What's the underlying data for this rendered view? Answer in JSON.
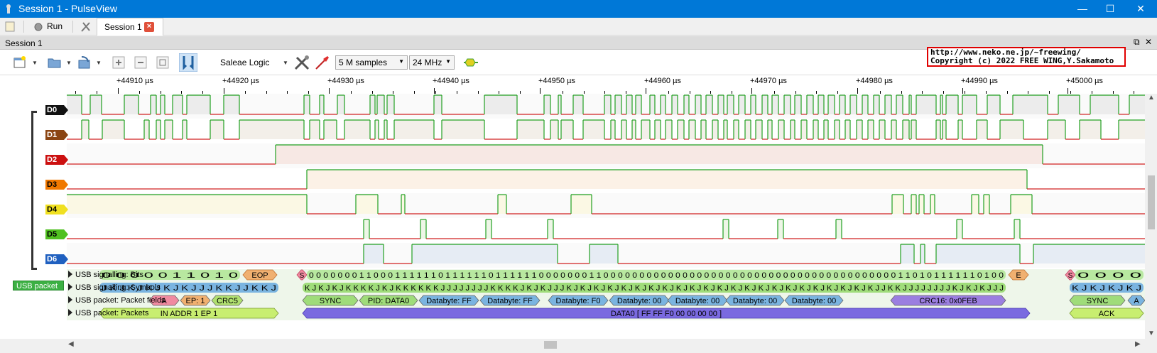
{
  "window": {
    "title": "Session 1 - PulseView",
    "minimize": "—",
    "maximize": "☐",
    "close": "✕"
  },
  "main_toolbar": {
    "run_label": "Run",
    "session_tab_label": "Session 1"
  },
  "session": {
    "header_label": "Session 1",
    "device": "Saleae Logic",
    "samples": "5 M samples",
    "rate": "24 MHz"
  },
  "copyright": {
    "line1": "http://www.neko.ne.jp/~freewing/",
    "line2": "Copyright (c) 2022 FREE WING,Y.Sakamoto"
  },
  "ruler": {
    "labels": [
      "+44910 µs",
      "+44920 µs",
      "+44930 µs",
      "+44940 µs",
      "+44950 µs",
      "+44960 µs",
      "+44970 µs",
      "+44980 µs",
      "+44990 µs",
      "+45000 µs"
    ]
  },
  "channels": [
    {
      "name": "D0",
      "color": "#111111",
      "text": "#ffffff",
      "bg": "#ececec"
    },
    {
      "name": "D1",
      "color": "#8b4513",
      "text": "#ffffff",
      "bg": "#f3efe9"
    },
    {
      "name": "D2",
      "color": "#cc1010",
      "text": "#ffffff",
      "bg": "#f7e8e4"
    },
    {
      "name": "D3",
      "color": "#f07800",
      "text": "#000000",
      "bg": "#fcf1e6"
    },
    {
      "name": "D4",
      "color": "#f0e020",
      "text": "#000000",
      "bg": "#fbf8e4"
    },
    {
      "name": "D5",
      "color": "#50c020",
      "text": "#000000",
      "bg": "#eef6e7"
    },
    {
      "name": "D6",
      "color": "#2060c0",
      "text": "#ffffff",
      "bg": "#e6ecf4"
    }
  ],
  "decoder": {
    "tag": "USB packet",
    "rows": [
      {
        "label": "USB signalling: Bits"
      },
      {
        "label": "USB signalling: Symbols"
      },
      {
        "label": "USB packet: Packet fields"
      },
      {
        "label": "USB packet: Packets"
      }
    ],
    "bits_left": "0 0 0 0 0 1 1 0 1 0",
    "bits_left_eop": "EOP",
    "bits_main": "0 0 0 0 0 0 0 1 1 0 0 0 1 1 1 1 1 1 0 1 1 1 1 1 1 0 1 1 1 1 1 1 0 0 0 0 0 0 0 1 1 0 0 0 0 0 0 0 0 0 0 0 0 0 0 0 0 0 0 0 0 0 0 0 0 0 0 0 0 0 0 0 0 0 0 0 0 0 0 0 0 0 1 1 0 1 0 1 1 1 1 1 1 0 1 0 0",
    "bits_main_end": "E",
    "bits_right": "0 0 0 0",
    "bits_s_left": "S",
    "bits_s_right": "S",
    "symbols_left": "J K J K J K J K J K J J J K K J J K K J",
    "symbols_main": "K J K J K J K K K K J K J K K K K K K J J J J J J J J K K K K J K J K J J J K J K J K J K J K J K J K J K J K J K J K J K J K J K J K J K J K J K J K J K J K J K J K J J K K J J J J J J J J K J K J K J J J",
    "symbols_right": "K J K J K J K J",
    "fields": [
      {
        "label": "SYNC",
        "color": "#9fdc7a"
      },
      {
        "label": "PID: DATA0",
        "color": "#9fdc7a"
      },
      {
        "label": "Databyte: FF",
        "color": "#7ab4e0"
      },
      {
        "label": "Databyte: FF",
        "color": "#7ab4e0"
      },
      {
        "label": "Databyte: F0",
        "color": "#7ab4e0"
      },
      {
        "label": "Databyte: 00",
        "color": "#7ab4e0"
      },
      {
        "label": "Databyte: 00",
        "color": "#7ab4e0"
      },
      {
        "label": "Databyte: 00",
        "color": "#7ab4e0"
      },
      {
        "label": "Databyte: 00",
        "color": "#7ab4e0"
      },
      {
        "label": "CRC16: 0x0FEB",
        "color": "#9b7ee0"
      }
    ],
    "fields_left": [
      {
        "label": "A",
        "color": "#f08aa0"
      },
      {
        "label": "EP: 1",
        "color": "#f0b070"
      },
      {
        "label": "CRC5",
        "color": "#b0e070"
      }
    ],
    "fields_right": [
      {
        "label": "SYNC",
        "color": "#9fdc7a"
      },
      {
        "label": "A",
        "color": "#7ab4e0"
      }
    ],
    "packet_left": "IN ADDR 1 EP 1",
    "packet_main": "DATA0 [ FF FF F0 00 00 00 00 ]",
    "packet_right": "ACK"
  }
}
